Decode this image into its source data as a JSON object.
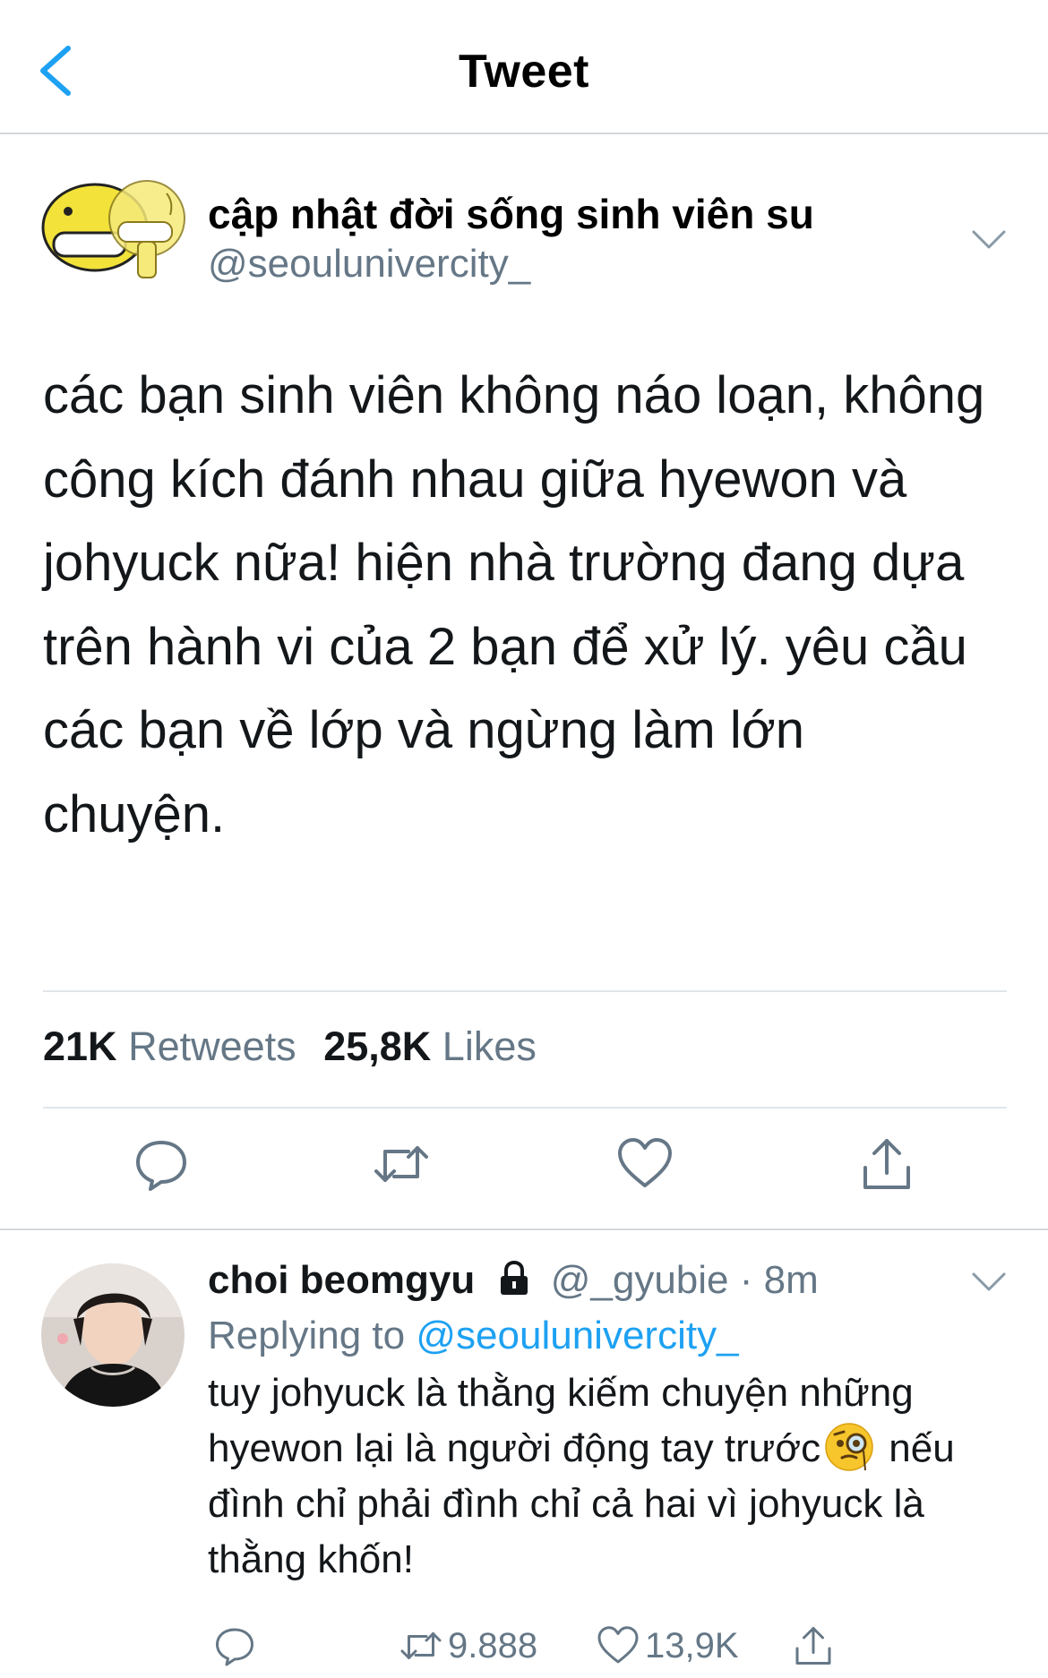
{
  "header": {
    "title": "Tweet",
    "back_icon": "chevron-left-icon"
  },
  "tweet": {
    "author_name": "cập nhật đời sống sinh viên su",
    "author_handle": "@seoulunivercity_",
    "text": "các bạn sinh viên không náo loạn, không công kích đánh nhau giữa hyewon và johyuck nữa! hiện nhà trường đang dựa trên hành vi của 2 bạn để xử lý. yêu cầu các bạn về lớp và ngừng làm lớn chuyện.",
    "stats": {
      "retweets_count": "21K",
      "retweets_label": "Retweets",
      "likes_count": "25,8K",
      "likes_label": "Likes"
    },
    "actions": [
      "reply-icon",
      "retweet-icon",
      "like-icon",
      "share-icon"
    ]
  },
  "reply": {
    "name": "choi beomgyu",
    "handle": "@_gyubie",
    "dot": "·",
    "time": "8m",
    "replying_prefix": "Replying to",
    "replying_to": "@seoulunivercity_",
    "text_part1": "tuy johyuck là thằng kiếm chuyện những hyewon lại là người động tay trước",
    "text_part2": " nếu đình chỉ phải đình chỉ cả hai vì johyuck là thằng khốn!",
    "retweet_count": "9.888",
    "like_count": "13,9K"
  },
  "colors": {
    "accent": "#1da1f2",
    "secondary_text": "#657786",
    "divider": "#e1e6ea"
  }
}
